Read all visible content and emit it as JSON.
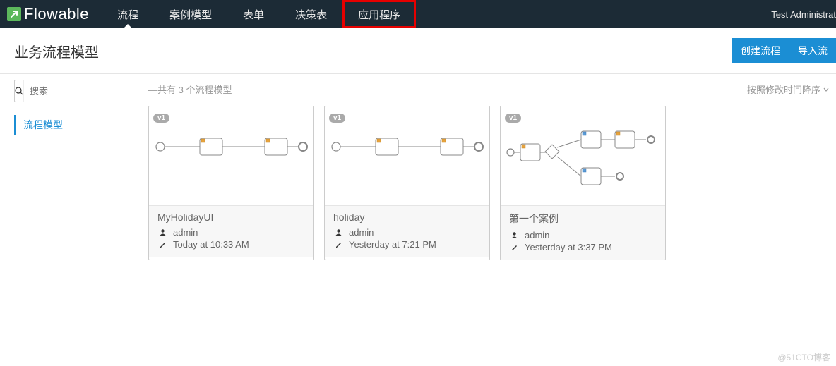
{
  "logo_text": "Flowable",
  "nav": {
    "tabs": [
      "流程",
      "案例模型",
      "表单",
      "决策表",
      "应用程序"
    ],
    "active_index": 0,
    "highlight_index": 4,
    "user": "Test Administrat"
  },
  "subheader": {
    "title": "业务流程模型",
    "create_btn": "创建流程",
    "import_btn": "导入流"
  },
  "sidebar": {
    "search_placeholder": "搜索",
    "item": "流程模型"
  },
  "toolbar": {
    "summary": "—共有 3 个流程模型",
    "sort_label": "按照修改时间降序"
  },
  "cards": [
    {
      "version": "v1",
      "title": "MyHolidayUI",
      "user": "admin",
      "modified": "Today at 10:33 AM",
      "diagram": "simple"
    },
    {
      "version": "v1",
      "title": "holiday",
      "user": "admin",
      "modified": "Yesterday at 7:21 PM",
      "diagram": "simple"
    },
    {
      "version": "v1",
      "title": "第一个案例",
      "user": "admin",
      "modified": "Yesterday at 3:37 PM",
      "diagram": "gateway"
    }
  ],
  "watermark": "@51CTO博客"
}
